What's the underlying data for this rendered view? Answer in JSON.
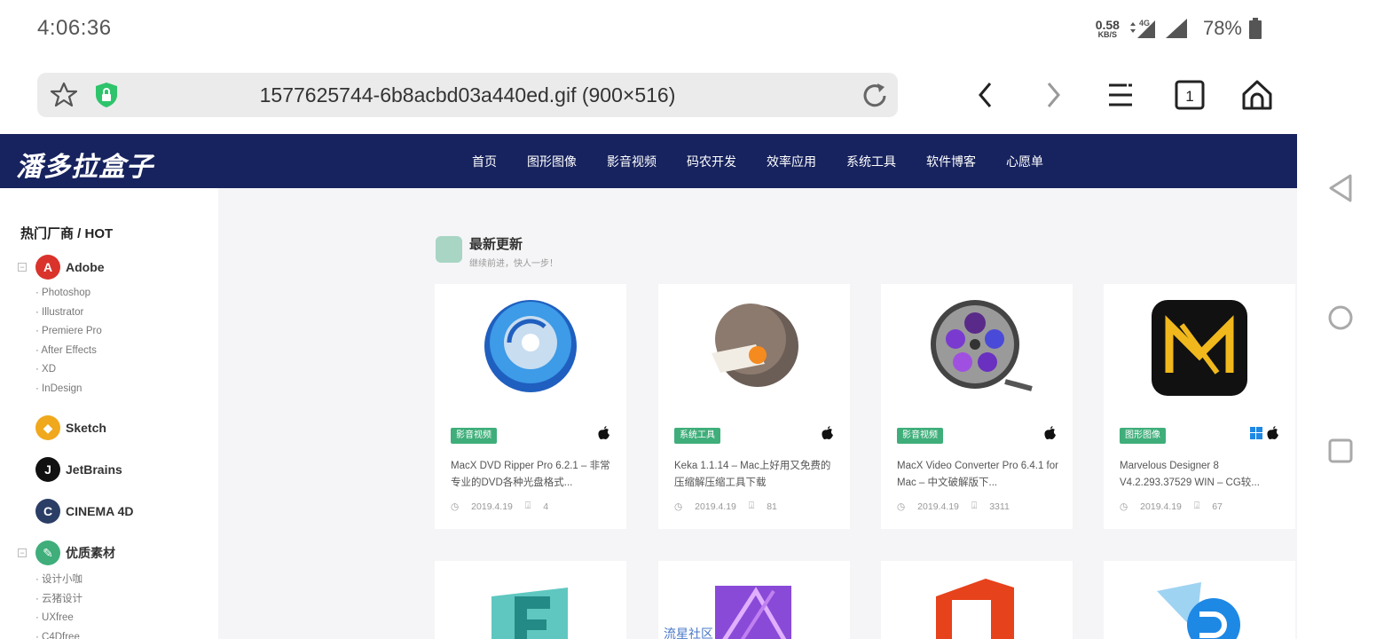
{
  "status_bar": {
    "time": "4:06:36",
    "net_speed_value": "0.58",
    "net_speed_unit": "KB/S",
    "network_type": "4G",
    "battery": "78%"
  },
  "browser": {
    "url": "1577625744-6b8acbd03a440ed.gif (900×516)",
    "tab_count": "1"
  },
  "site": {
    "logo": "潘多拉盒子",
    "nav": [
      "首页",
      "图形图像",
      "影音视频",
      "码农开发",
      "效率应用",
      "系统工具",
      "软件博客",
      "心愿单"
    ]
  },
  "sidebar": {
    "hot_title": "热门厂商 / HOT",
    "adobe": {
      "name": "Adobe",
      "items": [
        "Photoshop",
        "Illustrator",
        "Premiere Pro",
        "After Effects",
        "XD",
        "InDesign"
      ]
    },
    "sketch": "Sketch",
    "jetbrains": "JetBrains",
    "cinema4d": "CINEMA 4D",
    "materials": {
      "name": "优质素材",
      "items": [
        "设计小咖",
        "云猪设计",
        "UXfree",
        "C4Dfree"
      ]
    }
  },
  "section": {
    "title": "最新更新",
    "subtitle": "继续前进，快人一步！"
  },
  "cards": [
    {
      "tag": "影音视频",
      "title": "MacX DVD Ripper Pro 6.2.1 – 非常专业的DVD各种光盘格式...",
      "date": "2019.4.19",
      "downloads": "4",
      "os": [
        "mac"
      ]
    },
    {
      "tag": "系统工具",
      "title": "Keka 1.1.14 – Mac上好用又免费的压缩解压缩工具下载",
      "date": "2019.4.19",
      "downloads": "81",
      "os": [
        "mac"
      ]
    },
    {
      "tag": "影音视频",
      "title": "MacX Video Converter Pro 6.4.1 for Mac – 中文破解版下...",
      "date": "2019.4.19",
      "downloads": "3311",
      "os": [
        "mac"
      ]
    },
    {
      "tag": "图形图像",
      "title": "Marvelous Designer 8 V4.2.293.37529 WIN – CG较...",
      "date": "2019.4.19",
      "downloads": "67",
      "os": [
        "windows",
        "mac"
      ]
    }
  ],
  "watermark": "流星社区",
  "colors": {
    "header_bg": "#17235e",
    "tag_green": "#3fae7a"
  }
}
